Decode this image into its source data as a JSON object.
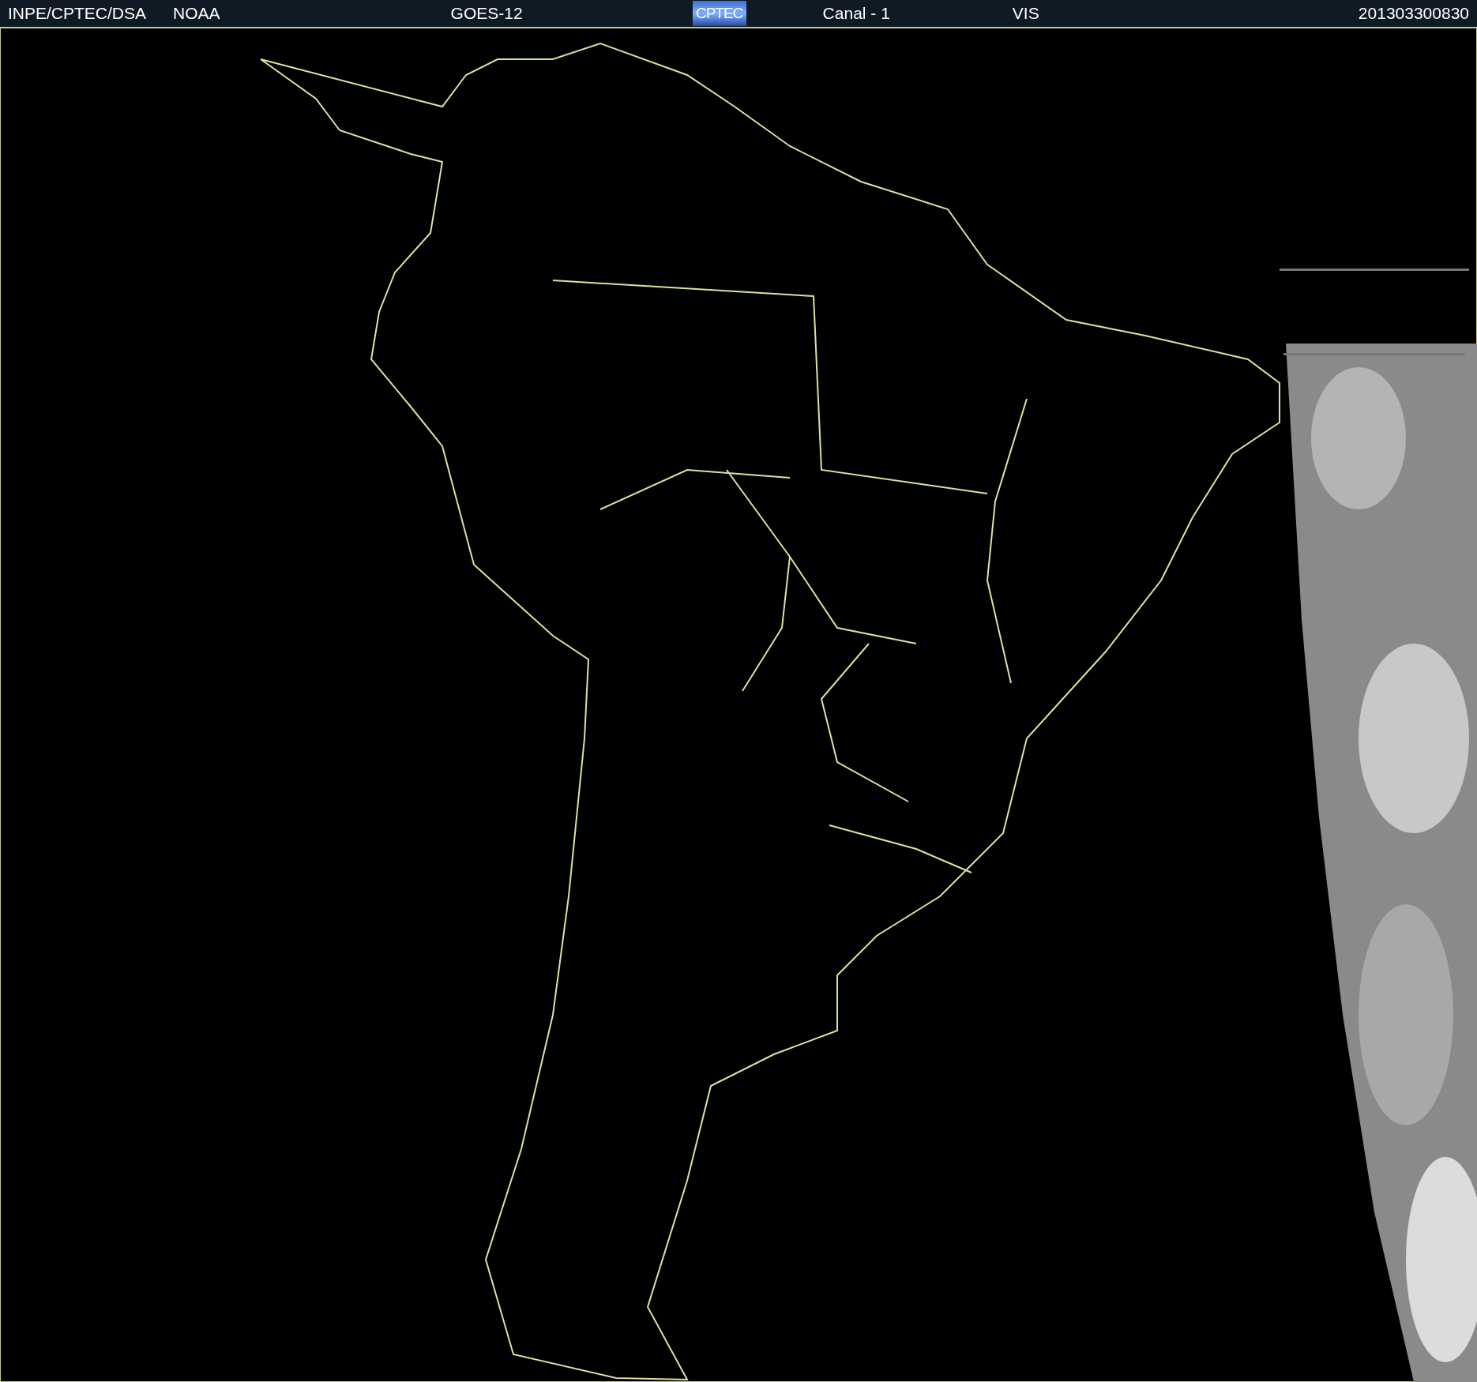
{
  "header": {
    "source": "INPE/CPTEC/DSA",
    "agency": "NOAA",
    "satellite": "GOES-12",
    "logo": "CPTEC",
    "channel": "Canal - 1",
    "band": "VIS",
    "timestamp": "201303300830"
  }
}
